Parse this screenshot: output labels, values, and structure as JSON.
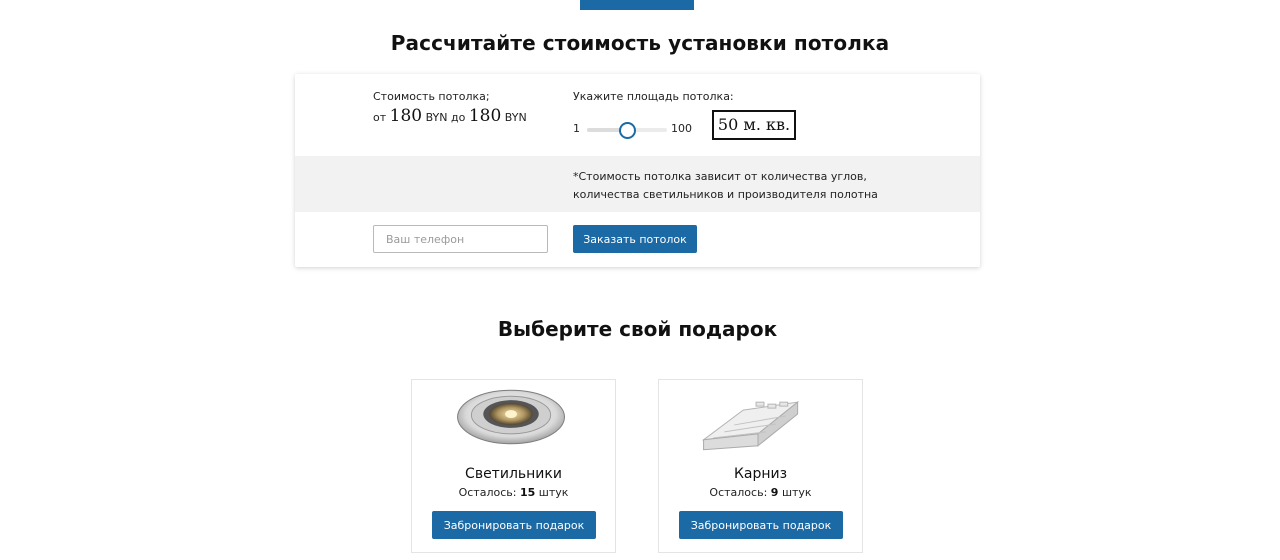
{
  "calculator": {
    "title": "Рассчитайте стоимость установки потолка",
    "price_label": "Стоимость потолка;",
    "price_from_prefix": "от",
    "price_from": "180",
    "currency": "BYN",
    "price_to_prefix": "до",
    "price_to": "180",
    "area_label": "Укажите площадь потолка:",
    "slider": {
      "min": "1",
      "max": "100",
      "value": 50
    },
    "area_value": "50 м. кв.",
    "note_line1": "*Стоимость потолка зависит от количества углов,",
    "note_line2": "количества светильников и производителя полотна",
    "phone_placeholder": "Ваш телефон",
    "order_button": "Заказать потолок"
  },
  "gifts": {
    "title": "Выберите свой подарок",
    "left_label": "Осталось:",
    "unit": "штук",
    "items": [
      {
        "name": "Светильники",
        "count": "15",
        "button": "Забронировать подарок",
        "icon": "spotlight-icon"
      },
      {
        "name": "Карниз",
        "count": "9",
        "button": "Забронировать подарок",
        "icon": "curtain-rail-icon"
      }
    ]
  },
  "colors": {
    "accent": "#1b6aa5",
    "band": "#f2f2f2"
  }
}
